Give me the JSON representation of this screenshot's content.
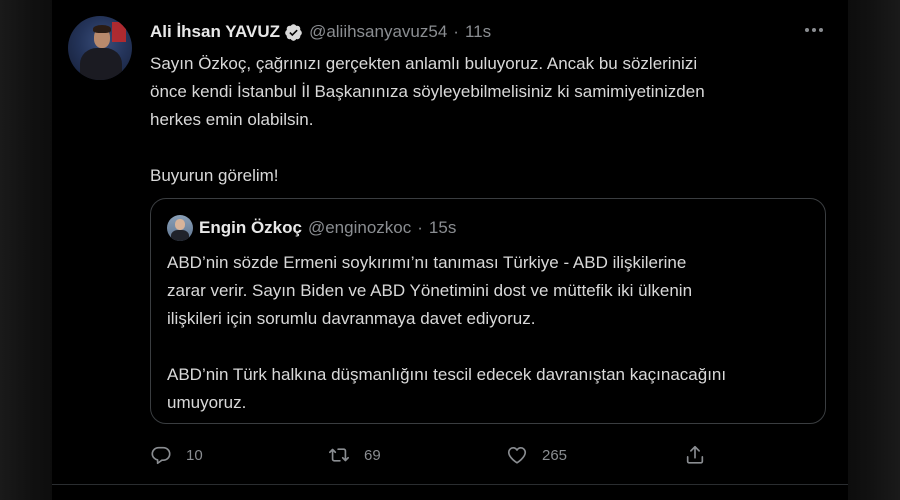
{
  "tweet": {
    "author_name": "Ali İhsan YAVUZ",
    "handle": "@aliihsanyavuz54",
    "time": "11s",
    "separator": "·",
    "text_lines": [
      "Sayın Özkoç, çağrınızı gerçekten anlamlı buluyoruz. Ancak bu sözlerinizi",
      "önce kendi İstanbul İl Başkanınıza  söyleyebilmelisiniz ki samimiyetinizden",
      "herkes emin olabilsin."
    ],
    "text_extra": "Buyurun görelim!",
    "icons": {
      "verified": "verified-badge-icon",
      "more": "more-dots-icon"
    }
  },
  "quoted": {
    "author_name": "Engin Özkoç",
    "handle": "@enginozkoc",
    "time": "15s",
    "separator": "·",
    "text_lines": [
      "ABD’nin sözde Ermeni soykırımı’nı tanıması Türkiye - ABD ilişkilerine",
      "zarar verir. Sayın Biden ve ABD Yönetimini dost ve müttefik iki ülkenin",
      "ilişkileri için sorumlu davranmaya davet ediyoruz."
    ],
    "text_lines_2": [
      "ABD’nin Türk halkına düşmanlığını tescil edecek davranıştan kaçınacağını",
      "umuyoruz."
    ]
  },
  "actions": {
    "reply_count": "10",
    "retweet_count": "69",
    "like_count": "265",
    "icons": [
      "reply-icon",
      "retweet-icon",
      "like-icon",
      "share-icon"
    ]
  },
  "colors": {
    "background": "#000000",
    "text": "#d9d9d9",
    "muted": "#8a8d91",
    "border": "#3a3d40"
  }
}
